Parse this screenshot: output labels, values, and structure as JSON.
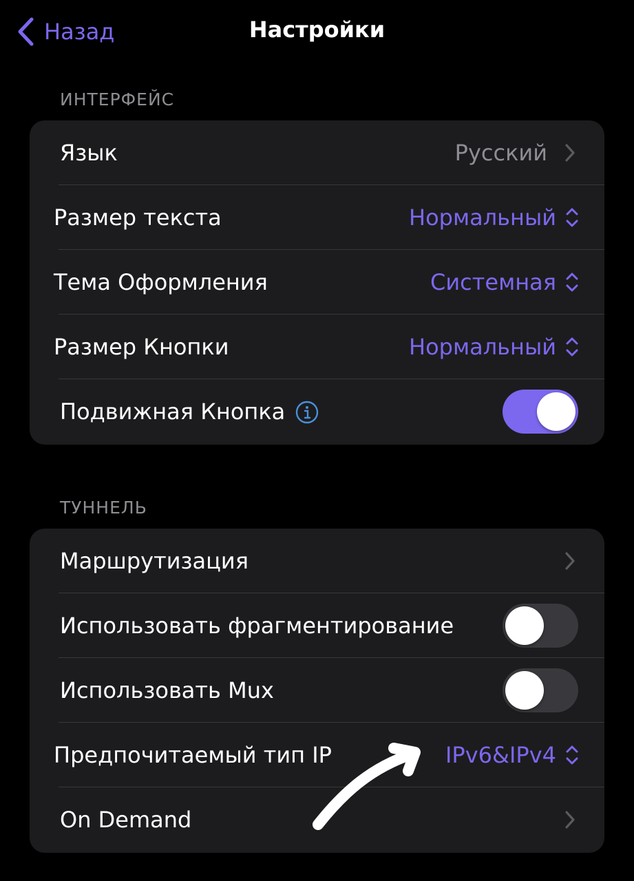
{
  "nav": {
    "back_label": "Назад",
    "title": "Настройки"
  },
  "sections": {
    "interface": {
      "header": "ИНТЕРФЕЙС",
      "language": {
        "label": "Язык",
        "value": "Русский"
      },
      "text_size": {
        "label": "Размер текста",
        "value": "Нормальный"
      },
      "theme": {
        "label": "Тема Оформления",
        "value": "Системная"
      },
      "button_size": {
        "label": "Размер Кнопки",
        "value": "Нормальный"
      },
      "movable_button": {
        "label": "Подвижная Кнопка",
        "enabled": true
      }
    },
    "tunnel": {
      "header": "ТУННЕЛЬ",
      "routing": {
        "label": "Маршрутизация"
      },
      "fragmentation": {
        "label": "Использовать фрагментирование",
        "enabled": false
      },
      "mux": {
        "label": "Использовать Mux",
        "enabled": false
      },
      "ip_type": {
        "label": "Предпочитаемый тип IP",
        "value": "IPv6&IPv4"
      },
      "on_demand": {
        "label": "On Demand"
      }
    }
  },
  "colors": {
    "accent": "#7b68ee",
    "background": "#000000",
    "group_background": "#1c1c1e",
    "secondary_text": "#8d8d93",
    "info_icon": "#4a90d9",
    "toggle_off": "#39393d"
  },
  "icons": {
    "back": "chevron-left-icon",
    "disclosure": "chevron-right-icon",
    "picker": "chevron-up-down-icon",
    "info": "info-circle-icon",
    "annotation": "hand-drawn-arrow"
  }
}
